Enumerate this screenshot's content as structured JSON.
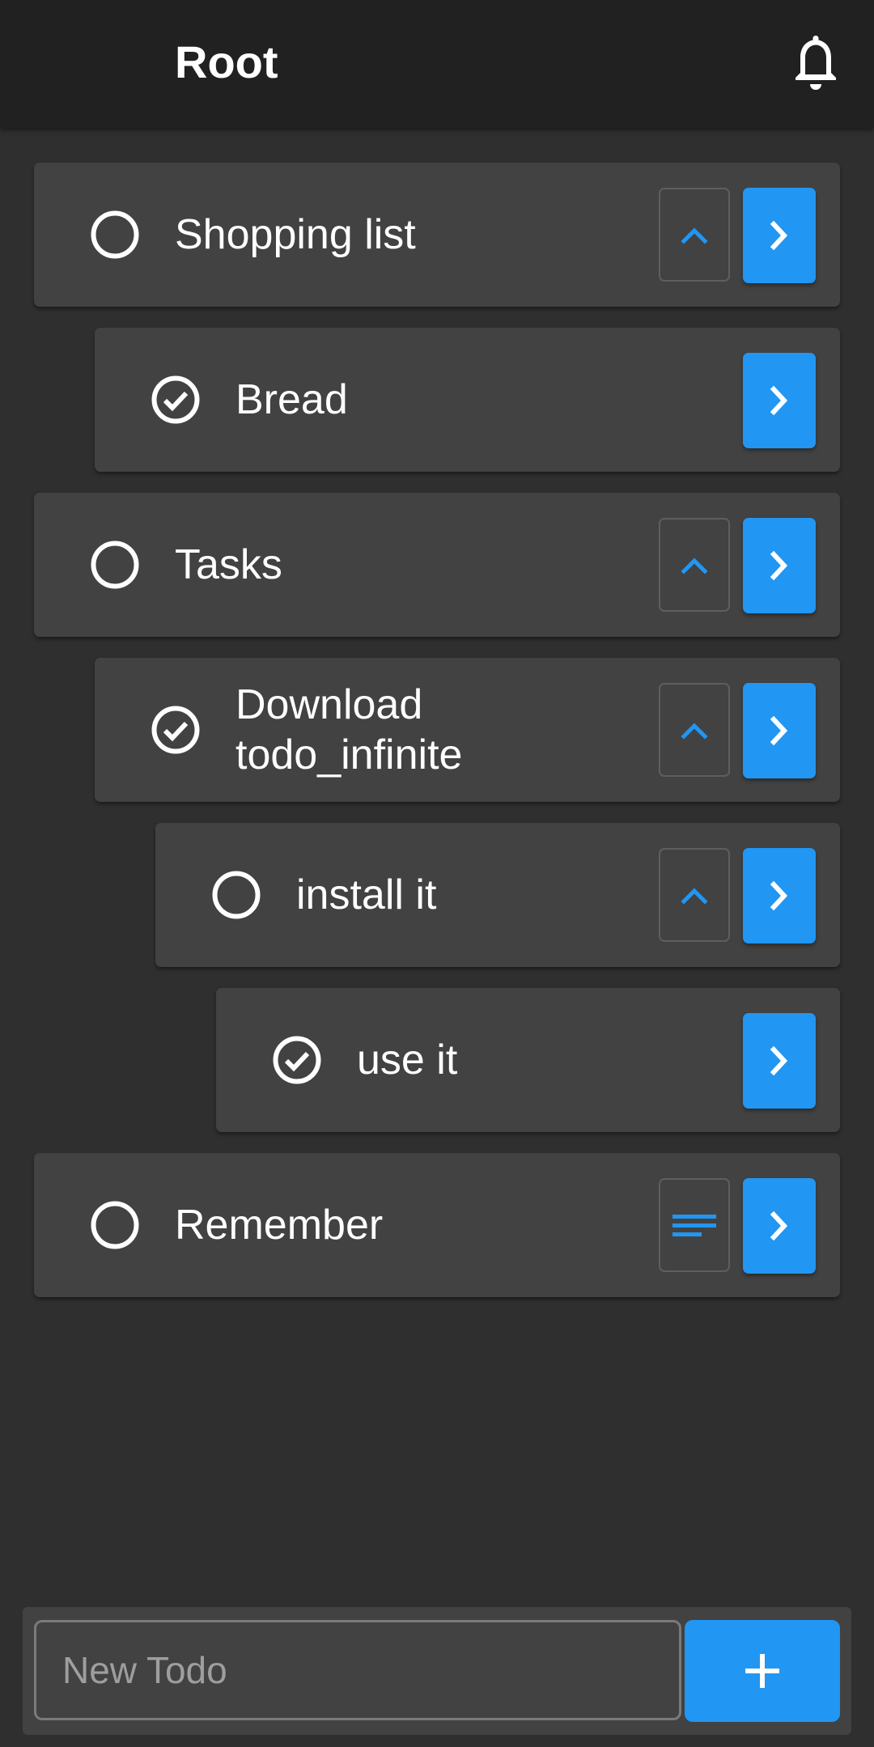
{
  "app_bar": {
    "title": "Root",
    "notifications_icon": "bell-icon"
  },
  "colors": {
    "background": "#2f2f2f",
    "app_bar": "#212121",
    "card": "#424242",
    "accent": "#2196f3",
    "text": "#ffffff",
    "placeholder": "#9e9e9e"
  },
  "todos": [
    {
      "label": "Shopping list",
      "done": false,
      "depth": 0,
      "action_icon": "chevron-up-icon",
      "open_icon": "chevron-right-icon"
    },
    {
      "label": "Bread",
      "done": true,
      "depth": 1,
      "action_icon": null,
      "open_icon": "chevron-right-icon"
    },
    {
      "label": "Tasks",
      "done": false,
      "depth": 0,
      "action_icon": "chevron-up-icon",
      "open_icon": "chevron-right-icon"
    },
    {
      "label": "Download todo_infinite",
      "done": true,
      "depth": 1,
      "action_icon": "chevron-up-icon",
      "open_icon": "chevron-right-icon"
    },
    {
      "label": "install it",
      "done": false,
      "depth": 2,
      "action_icon": "chevron-up-icon",
      "open_icon": "chevron-right-icon"
    },
    {
      "label": "use it",
      "done": true,
      "depth": 3,
      "action_icon": null,
      "open_icon": "chevron-right-icon"
    },
    {
      "label": "Remember",
      "done": false,
      "depth": 0,
      "action_icon": "notes-icon",
      "open_icon": "chevron-right-icon"
    }
  ],
  "new_todo": {
    "value": "",
    "placeholder": "New Todo",
    "add_icon": "plus-icon"
  }
}
